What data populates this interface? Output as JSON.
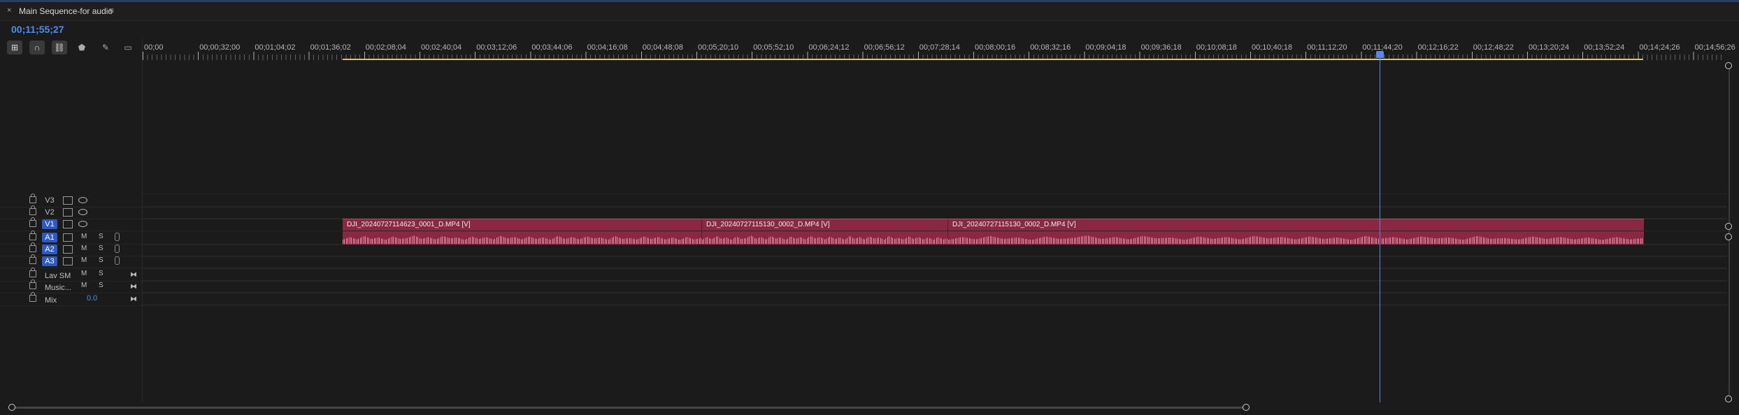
{
  "panel": {
    "close": "×",
    "title": "Main Sequence-for audio",
    "menu": "≡"
  },
  "timecode": "00;11;55;27",
  "ruler": {
    "labels": [
      "00;00",
      "00;00;32;00",
      "00;01;04;02",
      "00;01;36;02",
      "00;02;08;04",
      "00;02;40;04",
      "00;03;12;06",
      "00;03;44;06",
      "00;04;16;08",
      "00;04;48;08",
      "00;05;20;10",
      "00;05;52;10",
      "00;06;24;12",
      "00;06;56;12",
      "00;07;28;14",
      "00;08;00;16",
      "00;08;32;16",
      "00;09;04;18",
      "00;09;36;18",
      "00;10;08;18",
      "00;10;40;18",
      "00;11;12;20",
      "00;11;44;20",
      "00;12;16;22",
      "00;12;48;22",
      "00;13;20;24",
      "00;13;52;24",
      "00;14;24;26",
      "00;14;56;26"
    ]
  },
  "tracks": {
    "video": [
      {
        "name": "V3",
        "target": false
      },
      {
        "name": "V2",
        "target": false
      },
      {
        "name": "V1",
        "target": true
      }
    ],
    "audio": [
      {
        "name": "A1",
        "m": "M",
        "s": "S"
      },
      {
        "name": "A2",
        "m": "M",
        "s": "S"
      },
      {
        "name": "A3",
        "m": "M",
        "s": "S"
      }
    ],
    "submix": [
      {
        "name": "Lav SM",
        "m": "M",
        "s": "S"
      },
      {
        "name": "Music...",
        "m": "M",
        "s": "S"
      }
    ],
    "mix": {
      "name": "Mix",
      "value": "0.0"
    }
  },
  "clips": [
    {
      "label": "DJI_20240727114623_0001_D.MP4 [V]"
    },
    {
      "label": "DJI_20240727115130_0002_D.MP4 [V]"
    },
    {
      "label": "DJI_20240727115130_0002_D.MP4 [V]"
    }
  ],
  "colors": {
    "accent": "#4d8eea",
    "clip": "#8a2743",
    "work_area": "#e9c54a"
  }
}
